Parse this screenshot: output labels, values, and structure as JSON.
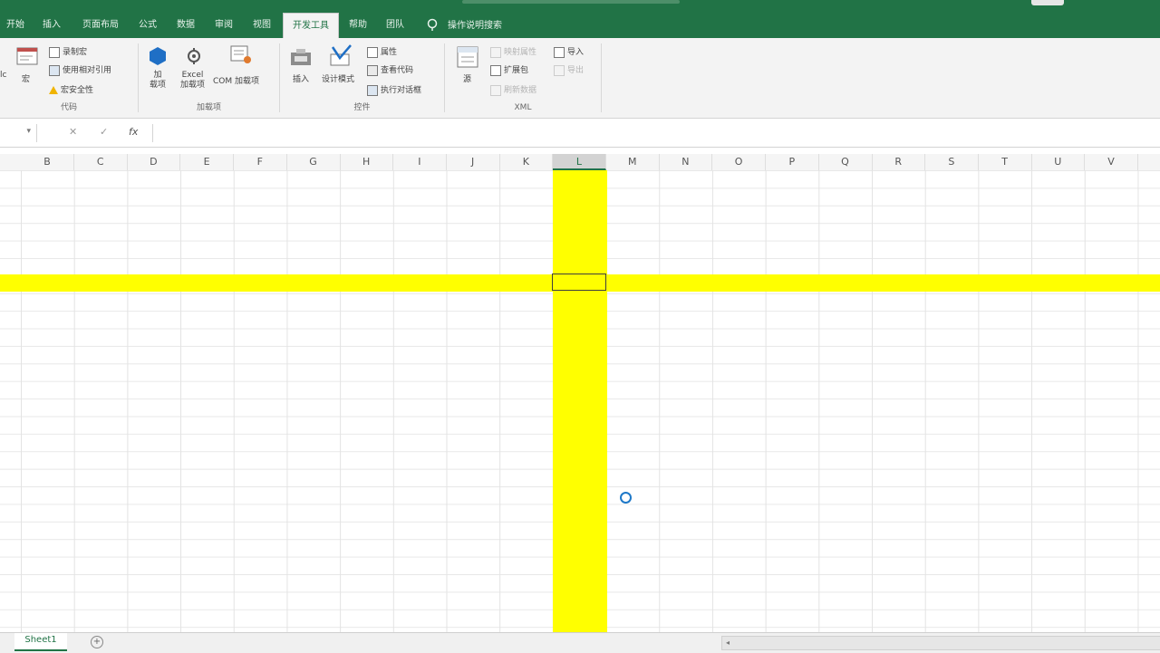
{
  "tabs": [
    {
      "label": "开始"
    },
    {
      "label": "插入"
    },
    {
      "label": "页面布局"
    },
    {
      "label": "公式"
    },
    {
      "label": "数据"
    },
    {
      "label": "审阅"
    },
    {
      "label": "视图"
    },
    {
      "label": "开发工具",
      "active": true
    },
    {
      "label": "帮助"
    },
    {
      "label": "团队"
    }
  ],
  "tell_me": "操作说明搜索",
  "ribbon": {
    "code": {
      "vb_label": "lc",
      "macro_label": "宏",
      "record_macro": "录制宏",
      "relative_refs": "使用相对引用",
      "macro_security": "宏安全性",
      "group_label": "代码"
    },
    "addins": {
      "addins_label": "加\n载项",
      "excel_addins_label": "Excel\n加载项",
      "com_addins_label": "COM 加载项",
      "group_label": "加载项"
    },
    "controls": {
      "insert_label": "插入",
      "design_mode_label": "设计模式",
      "properties": "属性",
      "view_code": "查看代码",
      "run_dialog": "执行对话框",
      "group_label": "控件"
    },
    "xml": {
      "source_label": "源",
      "map_properties": "映射属性",
      "expansion_packs": "扩展包",
      "refresh_data": "刷新数据",
      "import": "导入",
      "export": "导出",
      "group_label": "XML"
    }
  },
  "formula_bar": {
    "name_arrow": "▾",
    "cancel": "✕",
    "enter": "✓",
    "fx": "fx"
  },
  "columns": [
    "B",
    "C",
    "D",
    "E",
    "F",
    "G",
    "H",
    "I",
    "J",
    "K",
    "L",
    "M",
    "N",
    "O",
    "P",
    "Q",
    "R",
    "S",
    "T",
    "U",
    "V"
  ],
  "selected_column": "L",
  "sheets": [
    {
      "label": "Sheet1"
    }
  ],
  "add_sheet": "+",
  "colors": {
    "brand_green": "#217346",
    "highlight": "#ffff00",
    "cursor_blue": "#1e78c8"
  }
}
